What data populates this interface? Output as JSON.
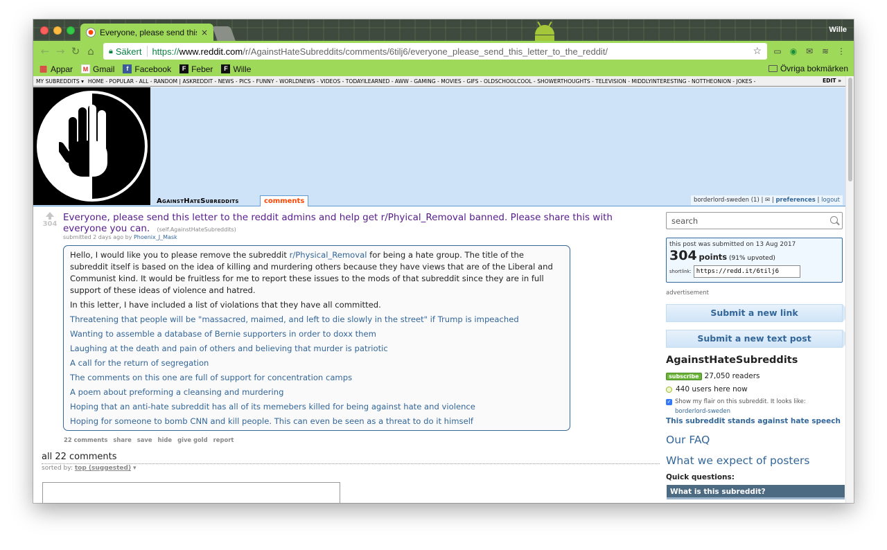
{
  "browser": {
    "tab_title": "Everyone, please send this letter to the reddit admins",
    "tab_close": "×",
    "profile": "Wille",
    "secure_label": "Säkert",
    "url_scheme": "https://",
    "url_host": "www.reddit.com",
    "url_path": "/r/AgainstHateSubreddits/comments/6tilj6/everyone_please_send_this_letter_to_the_reddit/",
    "bookmarks": [
      "Appar",
      "Gmail",
      "Facebook",
      "Feber",
      "Wille"
    ],
    "bookmarks_other": "Övriga bokmärken"
  },
  "srbar": {
    "my_subreddits": "MY SUBREDDITS",
    "links": "HOME - POPULAR - ALL - RANDOM  |  ASKREDDIT - NEWS - PICS - FUNNY - WORLDNEWS - VIDEOS - TODAYILEARNED - AWW - GAMING - MOVIES - GIFS - OLDSCHOOLCOOL - SHOWERTHOUGHTS - TELEVISION - MIDDLYINTERESTING - NOTTHEONION - JOKES -",
    "edit": "EDIT »"
  },
  "header": {
    "subreddit_name": "AgainstHateSubreddits",
    "tab_comments": "comments",
    "user": "borderlord-sweden",
    "karma": "(1)",
    "sep": "|",
    "preferences": "preferences",
    "logout": "logout"
  },
  "post": {
    "score": "304",
    "title": "Everyone, please send this letter to the reddit admins and help get r/Phyical_Removal banned. Please share this with everyone you can.",
    "domain": "(self.AgainstHateSubreddits)",
    "submitted": "submitted 2 days ago by",
    "author": "Phoenix_J_Mask",
    "para1_a": "Hello, I would like you to please remove the subreddit ",
    "para1_link": "r/Physical_Removal",
    "para1_b": " for being a hate group. The title of the subreddit itself is based on the idea of killing and murdering others because they have views that are of the Liberal and Communist kind. It would be fruitless for me to report these issues to the mods of that subreddit since they are in full support of these ideas of violence and hatred.",
    "para2": "In this letter, I have included a list of violations that they have all committed.",
    "violations": [
      "Threatening that people will be \"massacred, maimed, and left to die slowly in the street\" if Trump is impeached",
      "Wanting to assemble a database of Bernie supporters in order to doxx them",
      "Laughing at the death and pain of others and believing that murder is patriotic",
      "A call for the return of segregation",
      "The comments on this one are full of support for concentration camps",
      "A poem about preforming a cleansing and murdering",
      "Hoping that an anti-hate subreddit has all of its memebers killed for being against hate and violence",
      "Hoping for someone to bomb CNN and kill people. This can even be seen as a threat to do it himself"
    ],
    "actions": [
      "22 comments",
      "share",
      "save",
      "hide",
      "give gold",
      "report"
    ]
  },
  "comments": {
    "heading": "all 22 comments",
    "sorted_by": "sorted by:",
    "sort_value": "top (suggested)"
  },
  "sidebar": {
    "search_placeholder": "search",
    "submitted_on": "this post was submitted on 13 Aug 2017",
    "points": "304",
    "points_label": "points",
    "upvoted": "(91% upvoted)",
    "shortlink_label": "shortlink:",
    "shortlink": "https://redd.it/6tilj6",
    "advertisement": "advertisement",
    "submit_link": "Submit a new link",
    "submit_text": "Submit a new text post",
    "title": "AgainstHateSubreddits",
    "subscribe": "subscribe",
    "readers": "27,050 readers",
    "online": "440 users here now",
    "flair_text": "Show my flair on this subreddit. It looks like:",
    "flair_name": "borderlord-sweden",
    "stands_against": "This subreddit stands against hate speech",
    "faq": "Our FAQ",
    "expect": "What we expect of posters",
    "quick_questions": "Quick questions:",
    "what_is": "What is this subreddit?"
  }
}
